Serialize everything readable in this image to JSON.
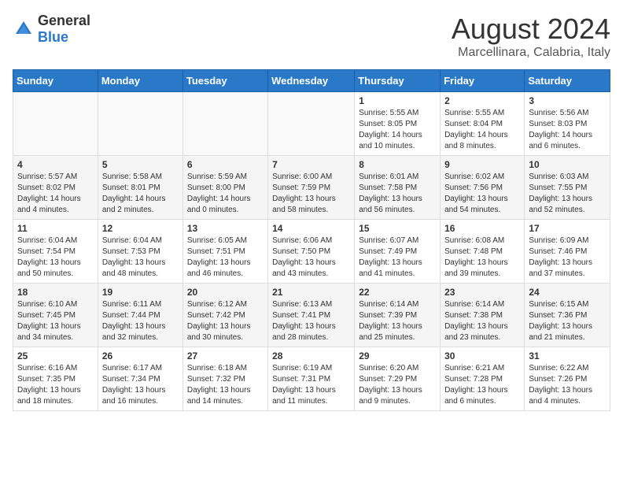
{
  "header": {
    "logo_general": "General",
    "logo_blue": "Blue",
    "month_title": "August 2024",
    "location": "Marcellinara, Calabria, Italy"
  },
  "weekdays": [
    "Sunday",
    "Monday",
    "Tuesday",
    "Wednesday",
    "Thursday",
    "Friday",
    "Saturday"
  ],
  "weeks": [
    [
      {
        "day": "",
        "info": ""
      },
      {
        "day": "",
        "info": ""
      },
      {
        "day": "",
        "info": ""
      },
      {
        "day": "",
        "info": ""
      },
      {
        "day": "1",
        "info": "Sunrise: 5:55 AM\nSunset: 8:05 PM\nDaylight: 14 hours\nand 10 minutes."
      },
      {
        "day": "2",
        "info": "Sunrise: 5:55 AM\nSunset: 8:04 PM\nDaylight: 14 hours\nand 8 minutes."
      },
      {
        "day": "3",
        "info": "Sunrise: 5:56 AM\nSunset: 8:03 PM\nDaylight: 14 hours\nand 6 minutes."
      }
    ],
    [
      {
        "day": "4",
        "info": "Sunrise: 5:57 AM\nSunset: 8:02 PM\nDaylight: 14 hours\nand 4 minutes."
      },
      {
        "day": "5",
        "info": "Sunrise: 5:58 AM\nSunset: 8:01 PM\nDaylight: 14 hours\nand 2 minutes."
      },
      {
        "day": "6",
        "info": "Sunrise: 5:59 AM\nSunset: 8:00 PM\nDaylight: 14 hours\nand 0 minutes."
      },
      {
        "day": "7",
        "info": "Sunrise: 6:00 AM\nSunset: 7:59 PM\nDaylight: 13 hours\nand 58 minutes."
      },
      {
        "day": "8",
        "info": "Sunrise: 6:01 AM\nSunset: 7:58 PM\nDaylight: 13 hours\nand 56 minutes."
      },
      {
        "day": "9",
        "info": "Sunrise: 6:02 AM\nSunset: 7:56 PM\nDaylight: 13 hours\nand 54 minutes."
      },
      {
        "day": "10",
        "info": "Sunrise: 6:03 AM\nSunset: 7:55 PM\nDaylight: 13 hours\nand 52 minutes."
      }
    ],
    [
      {
        "day": "11",
        "info": "Sunrise: 6:04 AM\nSunset: 7:54 PM\nDaylight: 13 hours\nand 50 minutes."
      },
      {
        "day": "12",
        "info": "Sunrise: 6:04 AM\nSunset: 7:53 PM\nDaylight: 13 hours\nand 48 minutes."
      },
      {
        "day": "13",
        "info": "Sunrise: 6:05 AM\nSunset: 7:51 PM\nDaylight: 13 hours\nand 46 minutes."
      },
      {
        "day": "14",
        "info": "Sunrise: 6:06 AM\nSunset: 7:50 PM\nDaylight: 13 hours\nand 43 minutes."
      },
      {
        "day": "15",
        "info": "Sunrise: 6:07 AM\nSunset: 7:49 PM\nDaylight: 13 hours\nand 41 minutes."
      },
      {
        "day": "16",
        "info": "Sunrise: 6:08 AM\nSunset: 7:48 PM\nDaylight: 13 hours\nand 39 minutes."
      },
      {
        "day": "17",
        "info": "Sunrise: 6:09 AM\nSunset: 7:46 PM\nDaylight: 13 hours\nand 37 minutes."
      }
    ],
    [
      {
        "day": "18",
        "info": "Sunrise: 6:10 AM\nSunset: 7:45 PM\nDaylight: 13 hours\nand 34 minutes."
      },
      {
        "day": "19",
        "info": "Sunrise: 6:11 AM\nSunset: 7:44 PM\nDaylight: 13 hours\nand 32 minutes."
      },
      {
        "day": "20",
        "info": "Sunrise: 6:12 AM\nSunset: 7:42 PM\nDaylight: 13 hours\nand 30 minutes."
      },
      {
        "day": "21",
        "info": "Sunrise: 6:13 AM\nSunset: 7:41 PM\nDaylight: 13 hours\nand 28 minutes."
      },
      {
        "day": "22",
        "info": "Sunrise: 6:14 AM\nSunset: 7:39 PM\nDaylight: 13 hours\nand 25 minutes."
      },
      {
        "day": "23",
        "info": "Sunrise: 6:14 AM\nSunset: 7:38 PM\nDaylight: 13 hours\nand 23 minutes."
      },
      {
        "day": "24",
        "info": "Sunrise: 6:15 AM\nSunset: 7:36 PM\nDaylight: 13 hours\nand 21 minutes."
      }
    ],
    [
      {
        "day": "25",
        "info": "Sunrise: 6:16 AM\nSunset: 7:35 PM\nDaylight: 13 hours\nand 18 minutes."
      },
      {
        "day": "26",
        "info": "Sunrise: 6:17 AM\nSunset: 7:34 PM\nDaylight: 13 hours\nand 16 minutes."
      },
      {
        "day": "27",
        "info": "Sunrise: 6:18 AM\nSunset: 7:32 PM\nDaylight: 13 hours\nand 14 minutes."
      },
      {
        "day": "28",
        "info": "Sunrise: 6:19 AM\nSunset: 7:31 PM\nDaylight: 13 hours\nand 11 minutes."
      },
      {
        "day": "29",
        "info": "Sunrise: 6:20 AM\nSunset: 7:29 PM\nDaylight: 13 hours\nand 9 minutes."
      },
      {
        "day": "30",
        "info": "Sunrise: 6:21 AM\nSunset: 7:28 PM\nDaylight: 13 hours\nand 6 minutes."
      },
      {
        "day": "31",
        "info": "Sunrise: 6:22 AM\nSunset: 7:26 PM\nDaylight: 13 hours\nand 4 minutes."
      }
    ]
  ]
}
